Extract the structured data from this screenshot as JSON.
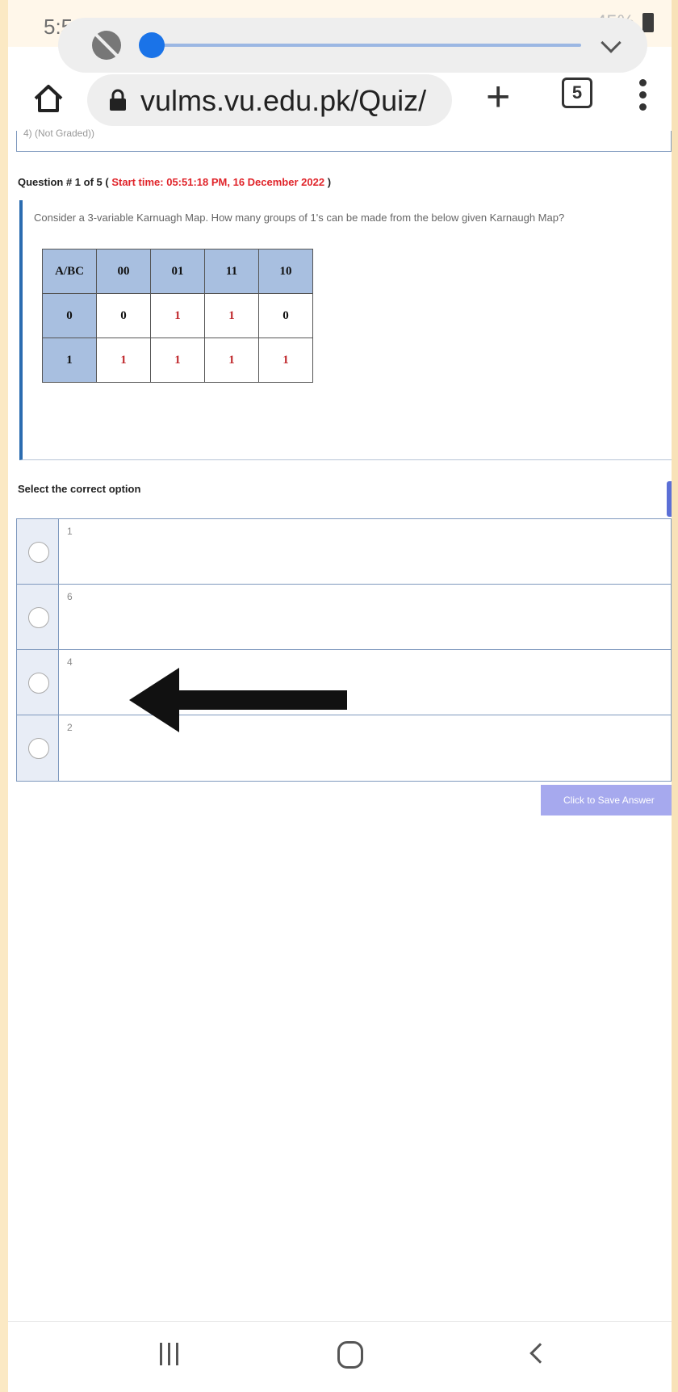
{
  "status_bar": {
    "time": "5:5",
    "battery": "45%"
  },
  "browser": {
    "url": "vulms.vu.edu.pk/Quiz/",
    "tab_count": "5"
  },
  "quiz": {
    "top_field_text": "4)  (Not Graded))",
    "question_prefix": "Question # 1 of 5 (",
    "start_time": "Start time: 05:51:18 PM, 16 December 2022",
    "question_suffix": ")",
    "question_text": "Consider a 3-variable Karnuagh Map. How many groups of 1's can be made from the below given Karnaugh Map?",
    "kmap": {
      "corner": "A/BC",
      "col_headers": [
        "00",
        "01",
        "11",
        "10"
      ],
      "rows": [
        {
          "label": "0",
          "cells": [
            "0",
            "1",
            "1",
            "0"
          ]
        },
        {
          "label": "1",
          "cells": [
            "1",
            "1",
            "1",
            "1"
          ]
        }
      ]
    },
    "select_label": "Select the correct option",
    "options": [
      "1",
      "6",
      "4",
      "2"
    ],
    "save_label": "Click to Save Answer"
  }
}
